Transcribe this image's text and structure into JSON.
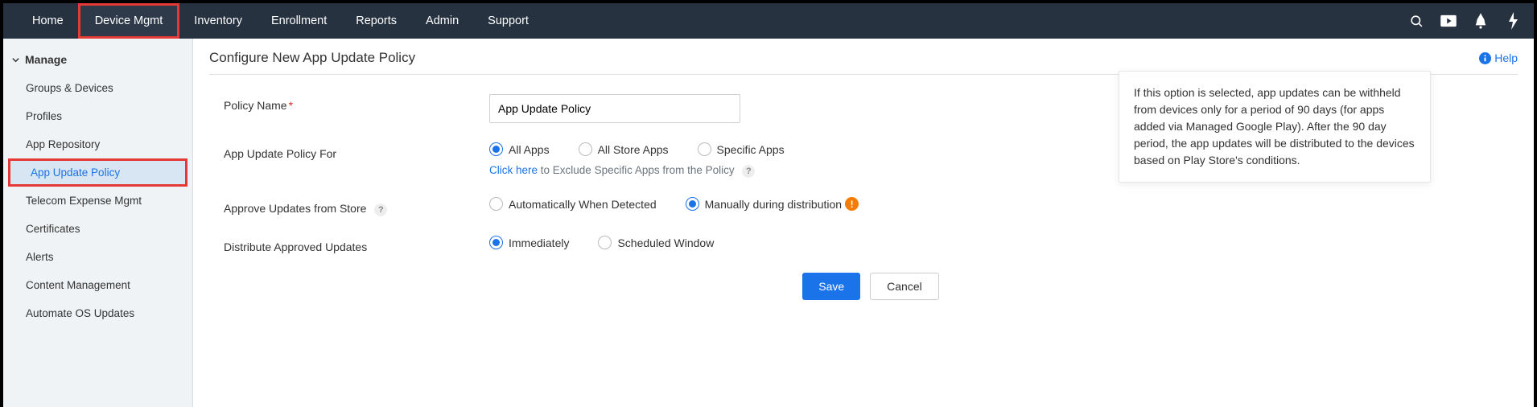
{
  "nav": {
    "tabs": [
      {
        "label": "Home"
      },
      {
        "label": "Device Mgmt"
      },
      {
        "label": "Inventory"
      },
      {
        "label": "Enrollment"
      },
      {
        "label": "Reports"
      },
      {
        "label": "Admin"
      },
      {
        "label": "Support"
      }
    ],
    "selected_index": 1
  },
  "sidebar": {
    "group_label": "Manage",
    "items": [
      {
        "label": "Groups & Devices"
      },
      {
        "label": "Profiles"
      },
      {
        "label": "App Repository"
      },
      {
        "label": "App Update Policy"
      },
      {
        "label": "Telecom Expense Mgmt"
      },
      {
        "label": "Certificates"
      },
      {
        "label": "Alerts"
      },
      {
        "label": "Content Management"
      },
      {
        "label": "Automate OS Updates"
      }
    ],
    "selected_index": 3
  },
  "page": {
    "title": "Configure New App Update Policy",
    "help_label": "Help"
  },
  "form": {
    "policy_name": {
      "label": "Policy Name",
      "value": "App Update Policy"
    },
    "policy_for": {
      "label": "App Update Policy For",
      "options": [
        "All Apps",
        "All Store Apps",
        "Specific Apps"
      ],
      "selected_index": 0,
      "hint_prefix": "Click here",
      "hint_rest": " to Exclude Specific Apps from the Policy"
    },
    "approve": {
      "label": "Approve Updates from Store",
      "options": [
        "Automatically When Detected",
        "Manually during distribution"
      ],
      "selected_index": 1
    },
    "distribute": {
      "label": "Distribute Approved Updates",
      "options": [
        "Immediately",
        "Scheduled Window"
      ],
      "selected_index": 0
    },
    "buttons": {
      "save": "Save",
      "cancel": "Cancel"
    }
  },
  "tooltip": {
    "text": "If this option is selected, app updates can be withheld from devices only for a period of 90 days (for apps added via Managed Google Play). After the 90 day period, the app updates will be distributed to the devices based on Play Store's conditions."
  }
}
